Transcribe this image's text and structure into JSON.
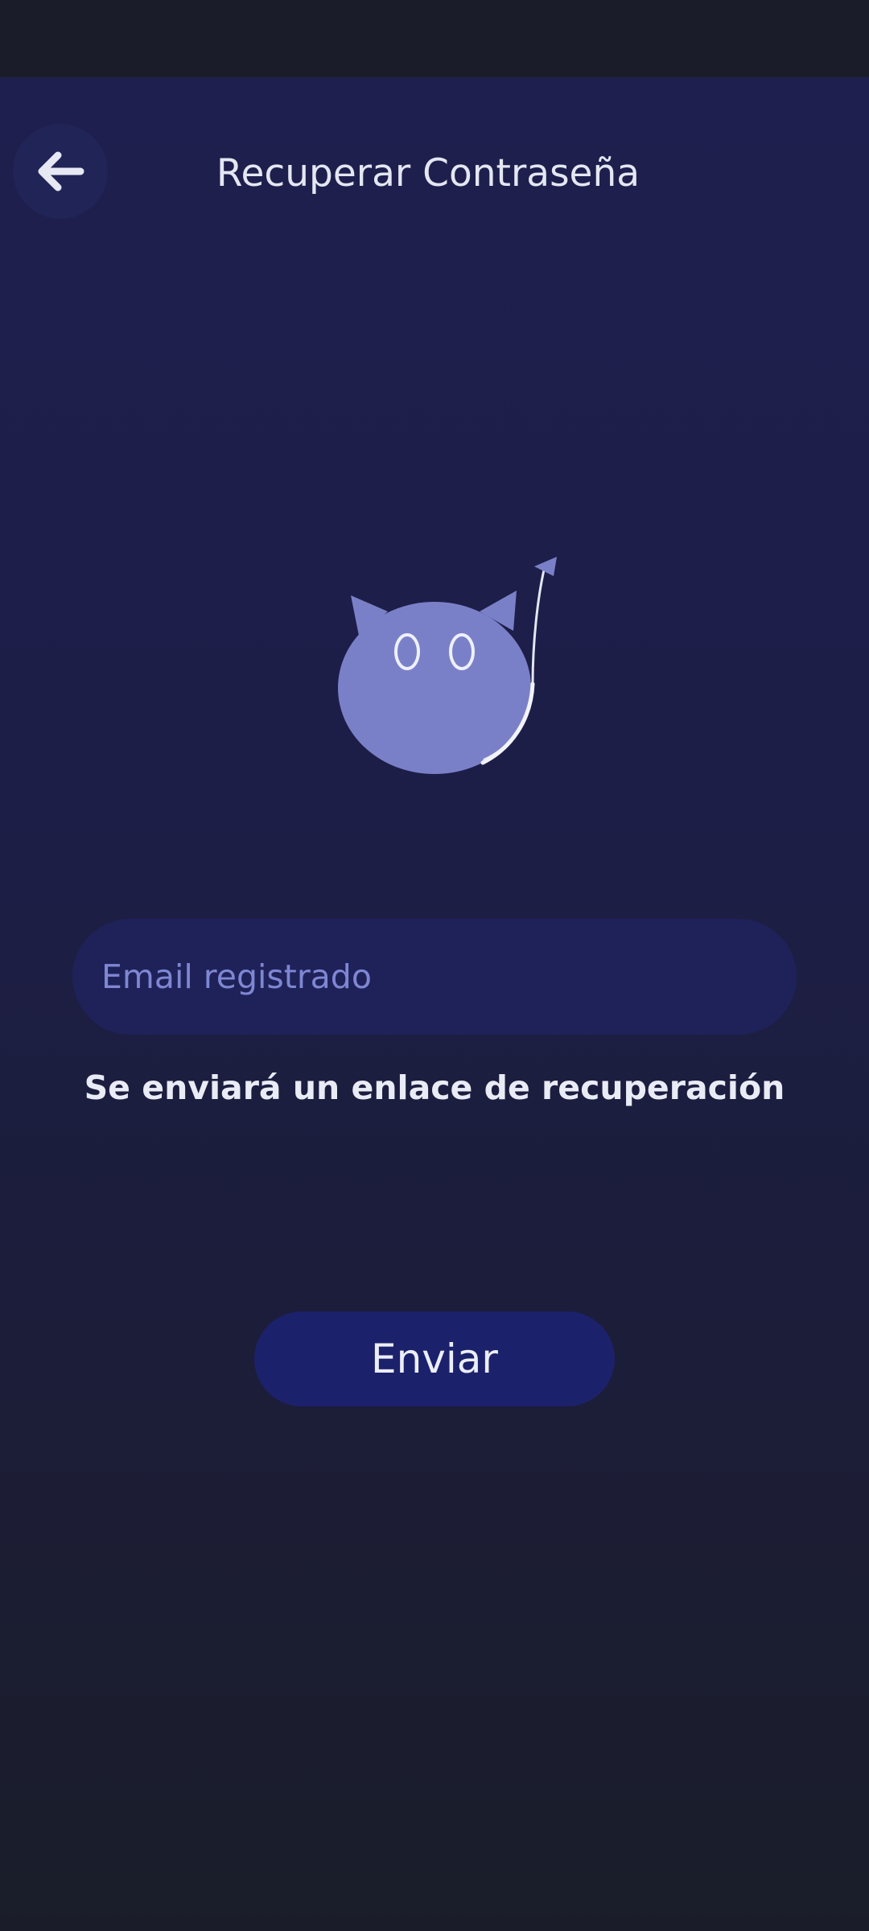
{
  "header": {
    "title": "Recuperar Contraseña",
    "back_icon": "arrow-left-icon"
  },
  "illustration": {
    "icon": "cat-mascot-icon",
    "body_color": "#7a80c8"
  },
  "form": {
    "email_value": "",
    "email_placeholder": "Email registrado",
    "helper": "Se enviará un enlace de recuperación",
    "submit_label": "Enviar"
  },
  "colors": {
    "background": "#1e1f4e",
    "input_background": "#1f2259",
    "placeholder": "#7f87d3",
    "button_background": "#1c216b",
    "text": "#e4e6f2"
  }
}
